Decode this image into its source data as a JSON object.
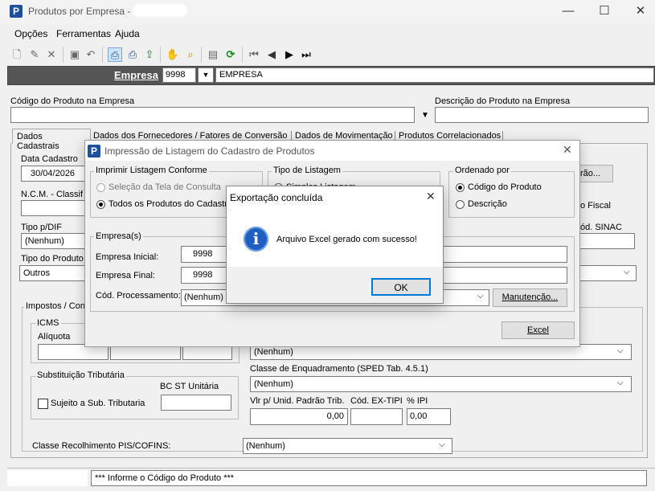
{
  "window": {
    "title": "Produtos por Empresa -",
    "controls": {
      "min": "—",
      "max": "☐",
      "close": "✕"
    }
  },
  "menu": [
    "Opções",
    "Ferramentas",
    "Ajuda"
  ],
  "toolbar_icons": [
    "new-doc-icon",
    "edit-icon",
    "delete-icon",
    "save-icon",
    "undo-icon",
    "print-icon",
    "print-setup-icon",
    "export-icon",
    "hand-icon",
    "search-icon",
    "properties-icon",
    "refresh-icon",
    "first-icon",
    "prev-icon",
    "next-icon",
    "last-icon"
  ],
  "empresa": {
    "label": "Empresa",
    "code": "9998",
    "name": "EMPRESA"
  },
  "product": {
    "code_label": "Código do Produto na Empresa",
    "desc_label": "Descrição do Produto na Empresa"
  },
  "tabs": [
    "Dados Cadastrais",
    "Dados dos Fornecedores / Fatores de Conversão",
    "Dados de Movimentação",
    "Produtos Correlacionados"
  ],
  "form": {
    "data_cadastro_label": "Data Cadastro",
    "data_cadastro": "30/04/2026",
    "ncm_label": "N.C.M. - Classif",
    "tipo_dif_label": "Tipo p/DIF",
    "tipo_dif": "(Nenhum)",
    "tipo_produto_label": "Tipo do Produto",
    "tipo_produto": "Outros",
    "impostos_label": "Impostos / Con",
    "icms_label": "ICMS",
    "aliquota_label": "Alíquota",
    "subst_label": "Substituição Tributária",
    "bc_st_label": "BC ST Unitária",
    "sujeito_label": "Sujeito a Sub. Tributaria",
    "classe_pis_label": "Classe Recolhimento PIS/COFINS:",
    "classe_pis": "(Nenhum)",
    "classe_enq_label": "Classe de Enquadramento (SPED Tab. 4.5.1)",
    "classe_enq": "(Nenhum)",
    "top_combo": "(Nenhum)",
    "vlr_label": "Vlr p/ Unid. Padrão Trib.",
    "vlr": "0,00",
    "cod_ex_label": "Cód. EX-TIPI",
    "ipi_label": "% IPI",
    "ipi": "0,00",
    "right_btn_partial": "rão...",
    "fiscal_partial": "o Fiscal",
    "sinac_partial": "ód. SINAC"
  },
  "status": {
    "text": "*** Informe o Código do Produto ***"
  },
  "dialog": {
    "title": "Impressão de Listagem do Cadastro de Produtos",
    "imprimir_label": "Imprimir Listagem Conforme",
    "opt_selecao": "Seleção da Tela de Consulta",
    "opt_todos": "Todos os Produtos do Cadastro",
    "tipo_label": "Tipo de Listagem",
    "tipo_partial": "Simples Listagem",
    "ordenado_label": "Ordenado por",
    "opt_codigo": "Código do Produto",
    "opt_descricao": "Descrição",
    "empresas_label": "Empresa(s)",
    "empresa_inicial_label": "Empresa Inicial:",
    "empresa_inicial": "9998",
    "empresa_final_label": "Empresa Final:",
    "empresa_final": "9998",
    "cod_proc_label": "Cód. Processamento:",
    "cod_proc": "(Nenhum)",
    "manutencao": "Manutenção...",
    "excel": "Excel"
  },
  "message": {
    "title": "Exportação concluída",
    "text": "Arquivo Excel gerado com sucesso!",
    "ok": "OK"
  },
  "colors": {
    "empresa_bar": "#555555",
    "info_icon": "#1f5fbf",
    "logo": "#1d4f9c"
  }
}
